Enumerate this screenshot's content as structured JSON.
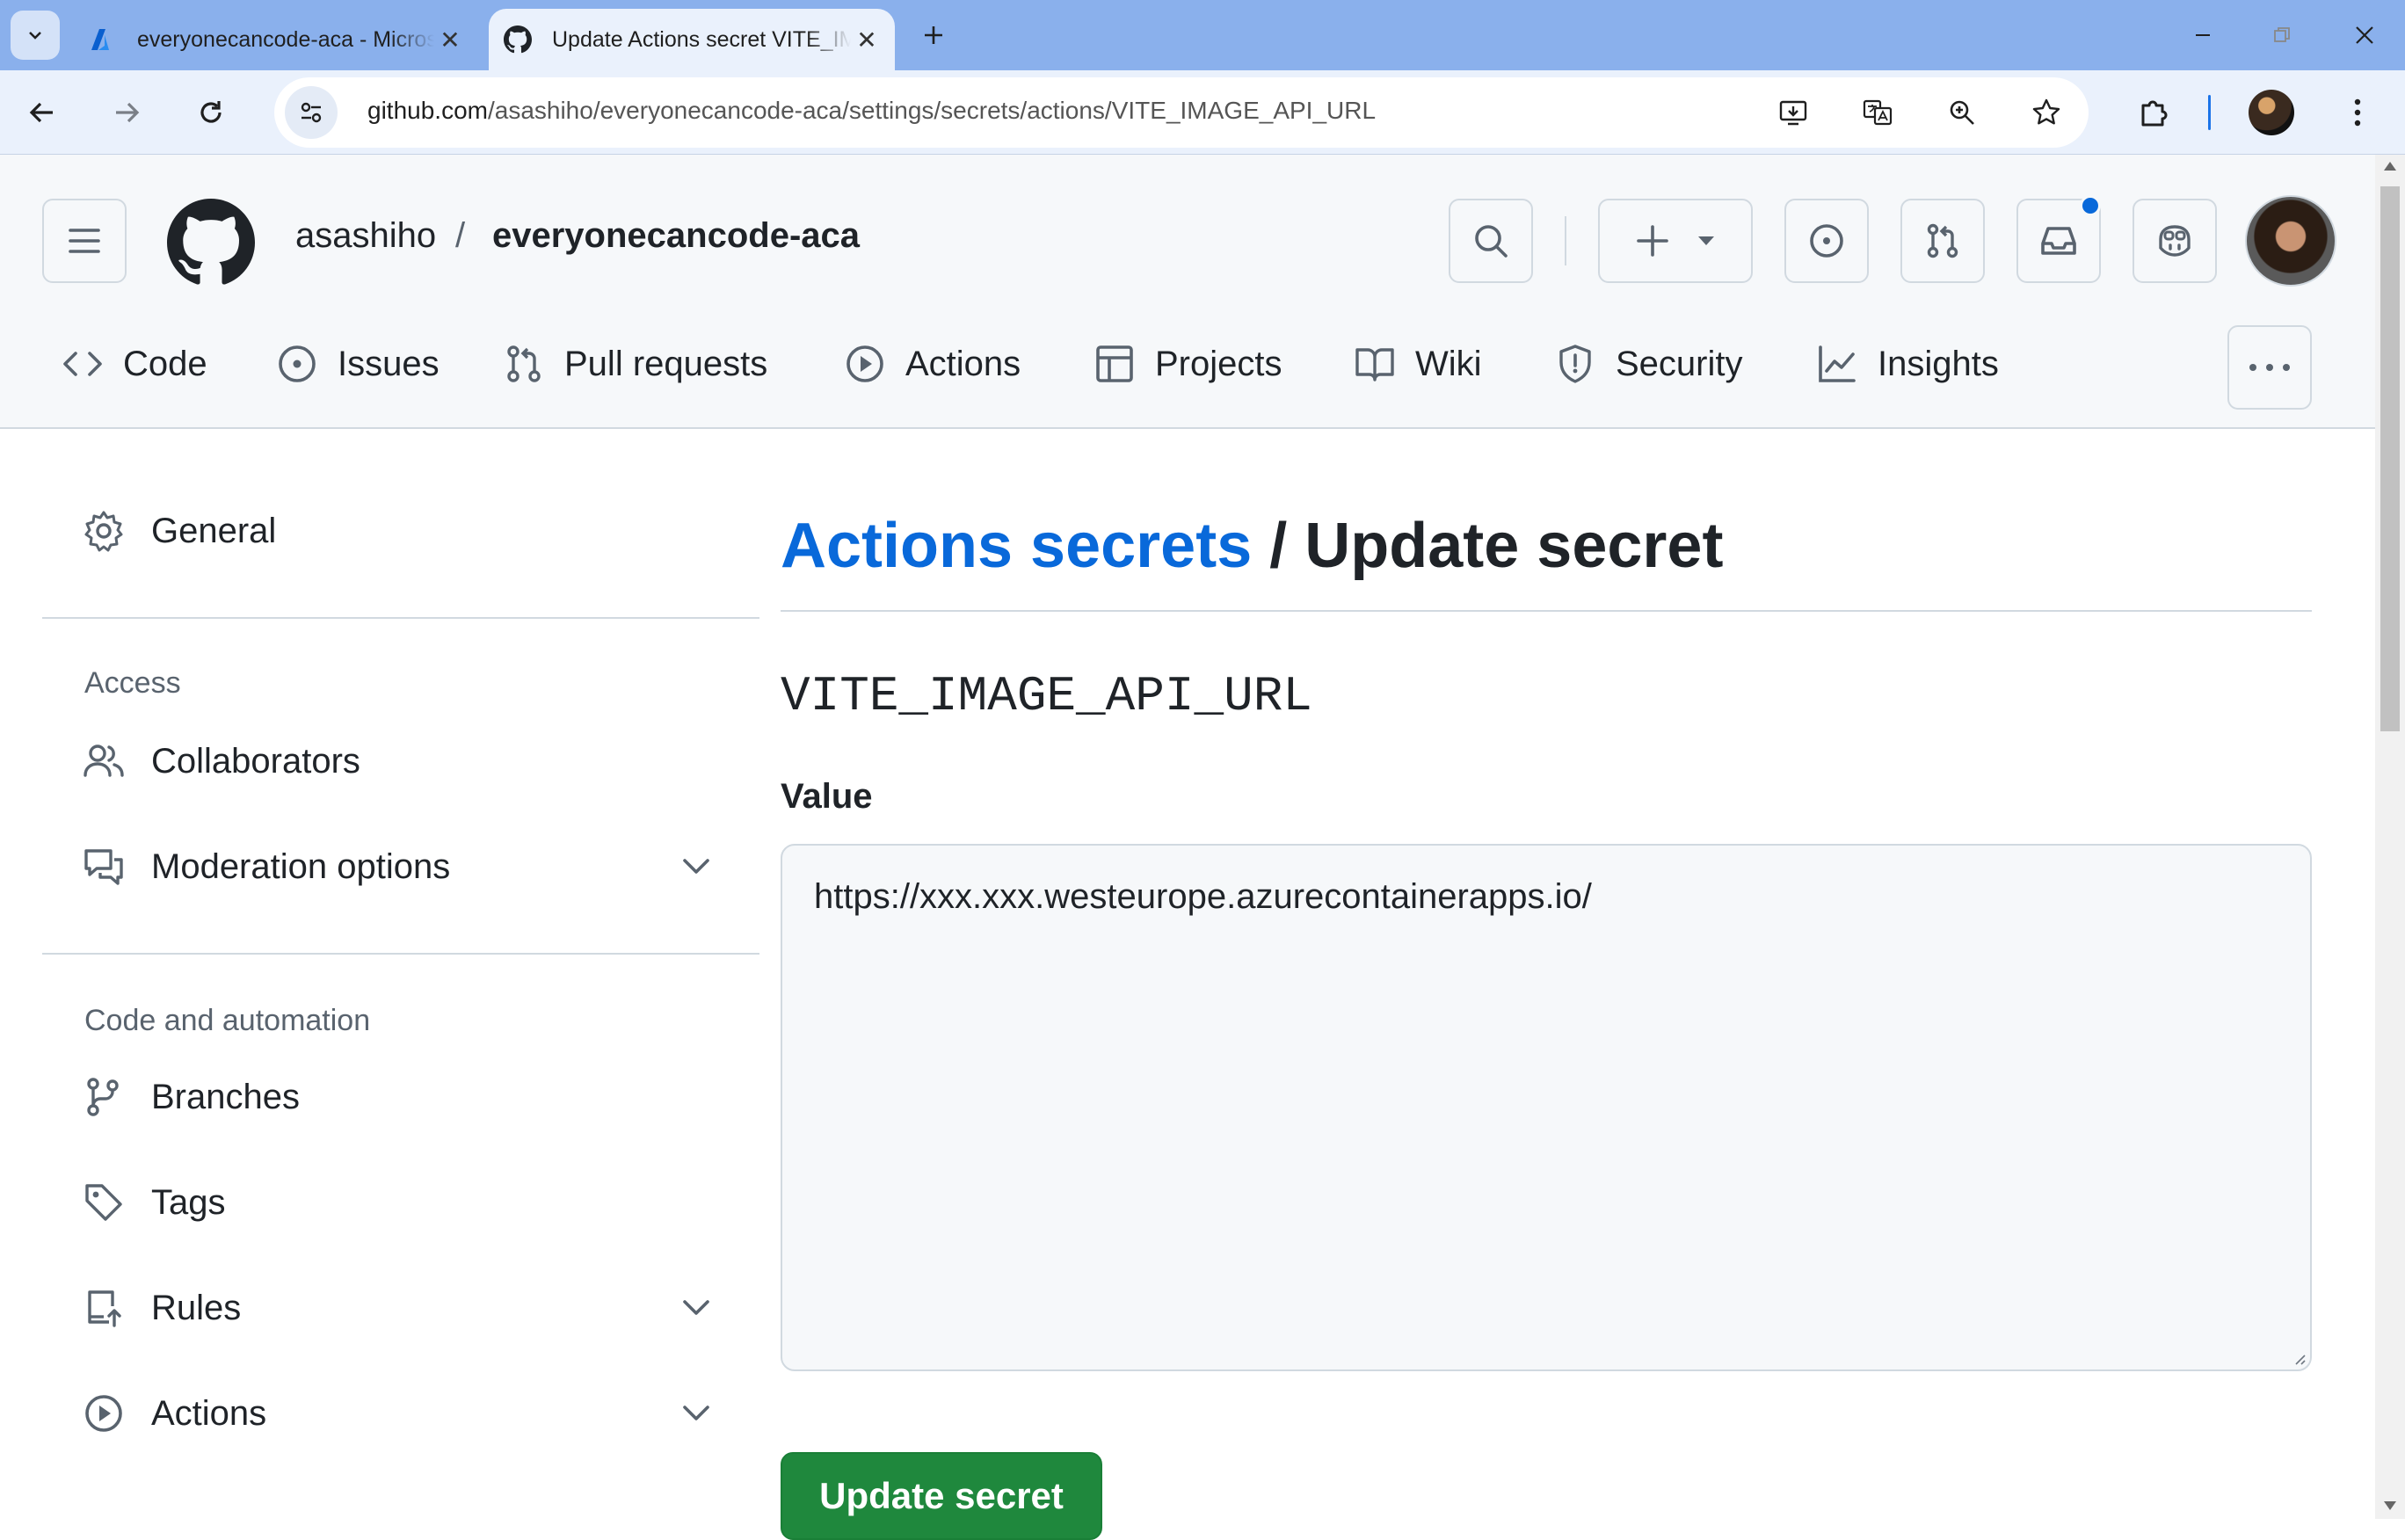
{
  "browser": {
    "tabs": [
      {
        "title": "everyonecancode-aca - Microsoft Azure",
        "active": false,
        "icon": "azure-icon"
      },
      {
        "title": "Update Actions secret VITE_IMAGE_API_URL",
        "active": true,
        "icon": "github-icon"
      }
    ],
    "url_host": "github.com",
    "url_path": "/asashiho/everyonecancode-aca/settings/secrets/actions/VITE_IMAGE_API_URL"
  },
  "header": {
    "owner": "asashiho",
    "separator": "/",
    "repo": "everyonecancode-aca",
    "notification_dot_color": "#0969da"
  },
  "repo_nav": [
    {
      "label": "Code",
      "icon": "code-icon"
    },
    {
      "label": "Issues",
      "icon": "issue-opened-icon"
    },
    {
      "label": "Pull requests",
      "icon": "git-pull-request-icon"
    },
    {
      "label": "Actions",
      "icon": "play-icon"
    },
    {
      "label": "Projects",
      "icon": "table-icon"
    },
    {
      "label": "Wiki",
      "icon": "book-icon"
    },
    {
      "label": "Security",
      "icon": "shield-icon"
    },
    {
      "label": "Insights",
      "icon": "graph-icon"
    }
  ],
  "sidebar": {
    "general": "General",
    "access_heading": "Access",
    "collaborators": "Collaborators",
    "moderation": "Moderation options",
    "code_heading": "Code and automation",
    "branches": "Branches",
    "tags": "Tags",
    "rules": "Rules",
    "actions": "Actions"
  },
  "main": {
    "title_link": "Actions secrets",
    "title_rest": " / Update secret",
    "secret_name": "VITE_IMAGE_API_URL",
    "value_label": "Value",
    "value": "https://xxx.xxx.westeurope.azurecontainerapps.io/",
    "submit_label": "Update secret",
    "submit_color": "#1f883d",
    "link_color": "#0969da"
  }
}
